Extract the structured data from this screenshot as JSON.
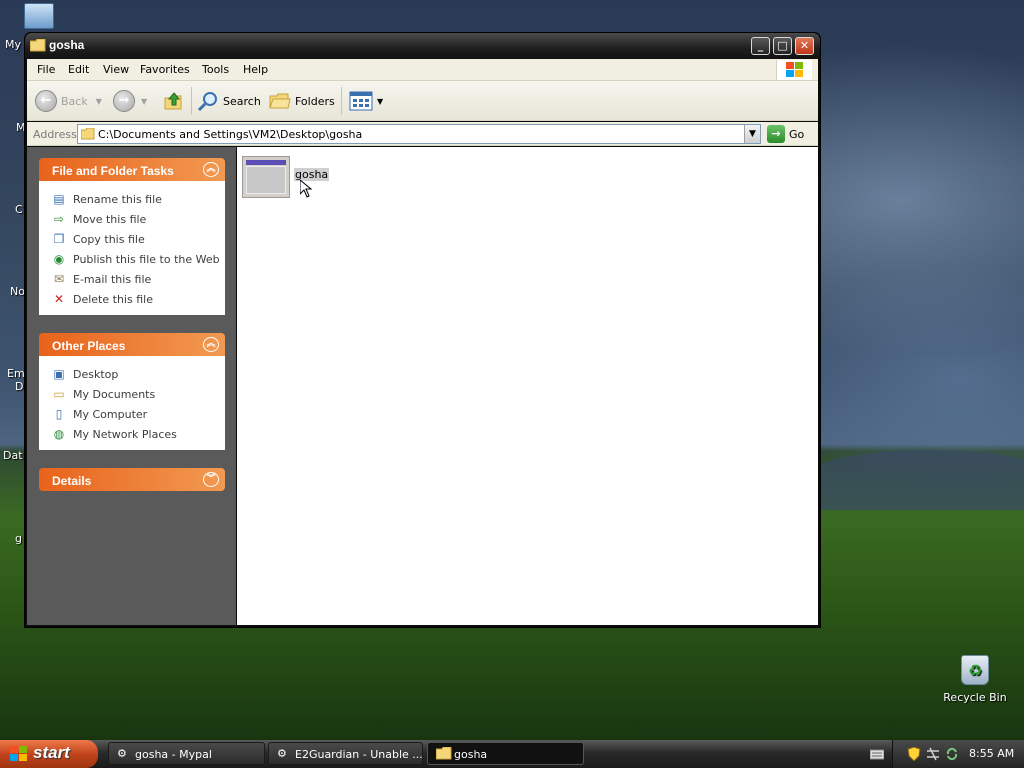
{
  "window": {
    "title": "gosha",
    "buttons": {
      "minimize": "_",
      "maximize": "□",
      "close": "✕"
    }
  },
  "menubar": {
    "items": [
      "File",
      "Edit",
      "View",
      "Favorites",
      "Tools",
      "Help"
    ]
  },
  "toolbar": {
    "back_label": "Back",
    "search_label": "Search",
    "folders_label": "Folders"
  },
  "address": {
    "label": "Address",
    "value": "C:\\Documents and Settings\\VM2\\Desktop\\gosha",
    "go_label": "Go"
  },
  "taskpane": {
    "file_tasks": {
      "title": "File and Folder Tasks",
      "items": [
        "Rename this file",
        "Move this file",
        "Copy this file",
        "Publish this file to the Web",
        "E-mail this file",
        "Delete this file"
      ]
    },
    "other_places": {
      "title": "Other Places",
      "items": [
        "Desktop",
        "My Documents",
        "My Computer",
        "My Network Places"
      ]
    },
    "details": {
      "title": "Details"
    }
  },
  "content": {
    "file_name": "gosha"
  },
  "desktop": {
    "fragments": [
      "My",
      "M",
      "C",
      "No",
      "Em",
      "D",
      "Dat",
      "g"
    ],
    "recycle_bin": "Recycle Bin"
  },
  "taskbar": {
    "start_label": "start",
    "tasks": [
      "gosha - Mypal",
      "E2Guardian - Unable ...",
      "gosha"
    ],
    "clock": "8:55 AM"
  },
  "colors": {
    "accent_orange": "#e8631b",
    "taskpane_gray": "#5a5a5a",
    "titlebar_dark": "#1e1e1e"
  }
}
